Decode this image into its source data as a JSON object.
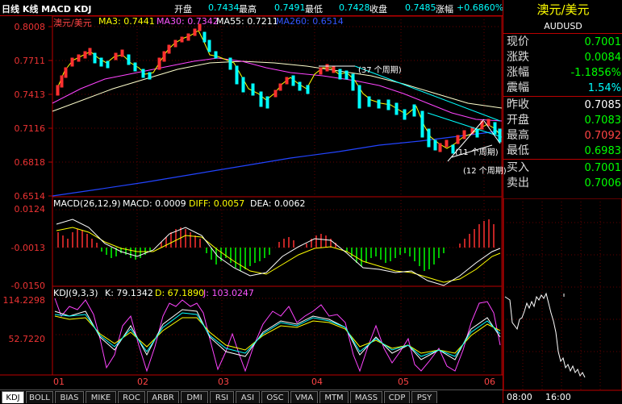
{
  "header": {
    "title": "日线 K线 MACD KDJ",
    "open_label": "开盘",
    "open_value": "0.7434",
    "high_label": "最高",
    "high_value": "0.7491",
    "low_label": "最低",
    "low_value": "0.7428",
    "close_label": "收盘",
    "close_value": "0.7485",
    "change_label": "涨幅",
    "change_value": "+0.6860%"
  },
  "price_panel": {
    "pair": "澳元/美元",
    "ma3": "MA3: 0.7441",
    "ma30": "MA30: 0.7342",
    "ma55": "MA55: 0.7211",
    "ma260": "MA260: 0.6514",
    "y_ticks": [
      "0.8008",
      "0.7711",
      "0.7413",
      "0.7116",
      "0.6818",
      "0.6514"
    ],
    "annot_37": "(37 个周期)",
    "annot_11": "(11 个周期)",
    "annot_12": "(12 个周期)"
  },
  "macd_panel": {
    "title": "MACD(26,12,9)",
    "macd": "MACD: 0.0009",
    "diff": "DIFF: 0.0057",
    "dea": "DEA: 0.0062",
    "y_ticks": [
      "0.0124",
      "-0.0013",
      "-0.0150"
    ]
  },
  "kdj_panel": {
    "title": "KDJ(9,3,3)",
    "k": "K: 79.1342",
    "d": "D: 67.1890",
    "j": "J: 103.0247",
    "y_ticks": [
      "114.2298",
      "52.7220"
    ]
  },
  "x_axis": [
    "01",
    "02",
    "03",
    "04",
    "05",
    "06"
  ],
  "quote": {
    "name": "澳元/美元",
    "code": "AUDUSD",
    "rows": [
      {
        "label": "现价",
        "value": "0.7001",
        "color": "#00ff00"
      },
      {
        "label": "涨跌",
        "value": "0.0084",
        "color": "#00ff00"
      },
      {
        "label": "涨幅",
        "value": "-1.1856%",
        "color": "#00ff00"
      },
      {
        "label": "震幅",
        "value": "1.54%",
        "color": "#00ffff"
      },
      {
        "label": "昨收",
        "value": "0.7085",
        "color": "#ffffff"
      },
      {
        "label": "开盘",
        "value": "0.7083",
        "color": "#00ff00"
      },
      {
        "label": "最高",
        "value": "0.7092",
        "color": "#ff4444"
      },
      {
        "label": "最低",
        "value": "0.6983",
        "color": "#00ff00"
      },
      {
        "label": "买入",
        "value": "0.7001",
        "color": "#00ff00"
      },
      {
        "label": "卖出",
        "value": "0.7006",
        "color": "#00ff00"
      }
    ],
    "intraday_times": [
      "08:00",
      "16:00"
    ]
  },
  "tabs": [
    "KDJ",
    "BOLL",
    "BIAS",
    "MIKE",
    "ROC",
    "ARBR",
    "DMI",
    "RSI",
    "ASI",
    "OSC",
    "VMA",
    "MTM",
    "MASS",
    "CDP",
    "PSY"
  ],
  "active_tab": "KDJ"
}
